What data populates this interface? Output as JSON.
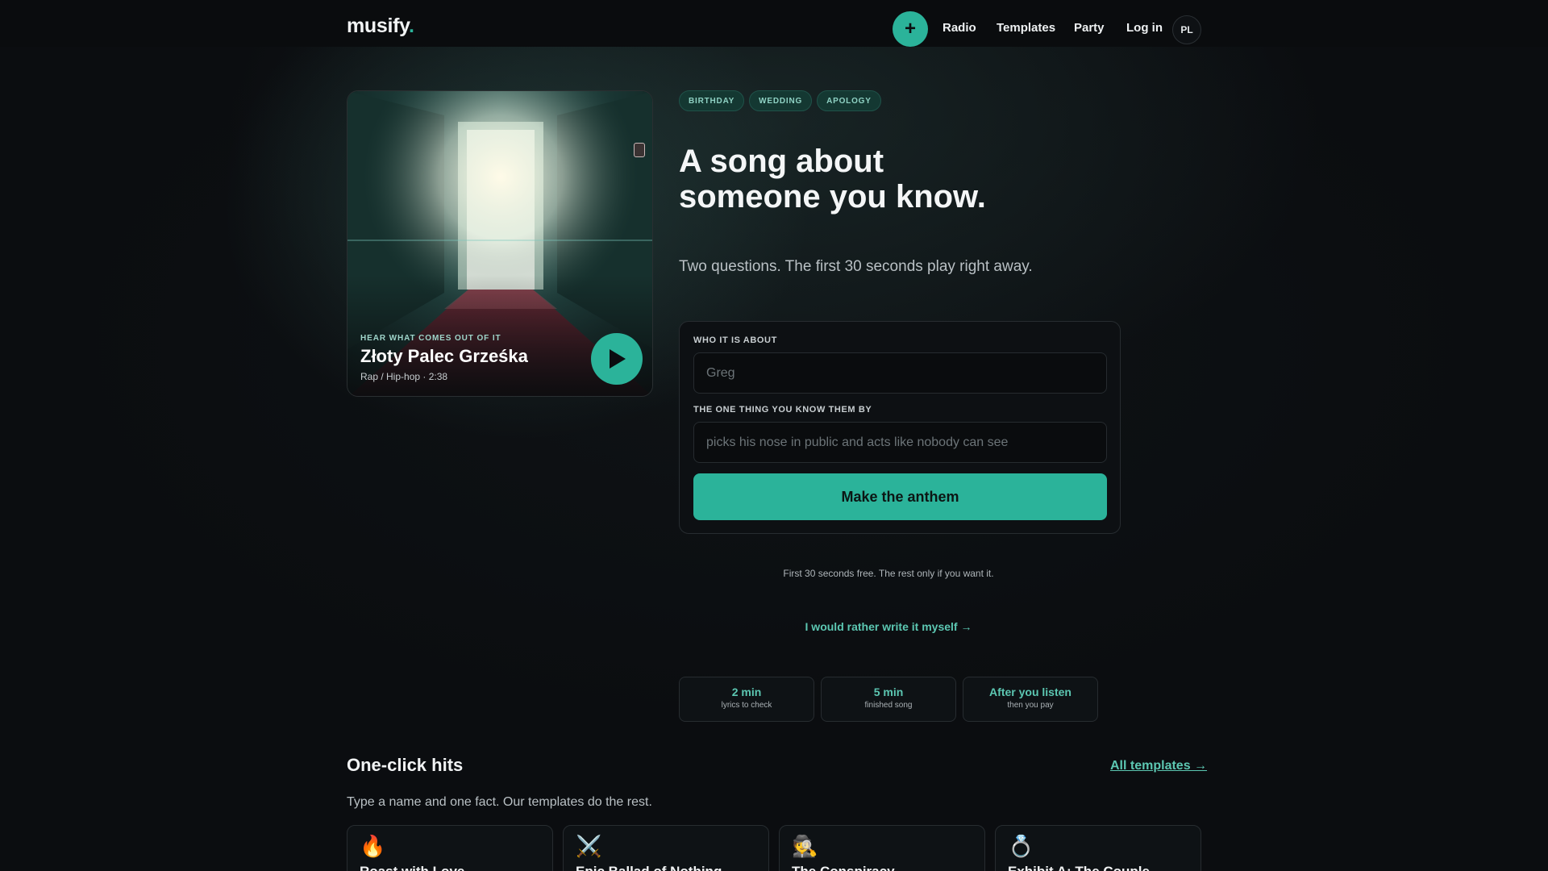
{
  "nav": {
    "logo": "musify",
    "logo_dot": ".",
    "plus_label": "+",
    "links": [
      "Radio",
      "Templates",
      "Party",
      "Log in"
    ],
    "lang": "PL"
  },
  "hero_card": {
    "eyebrow": "HEAR WHAT COMES OUT OF IT",
    "title": "Złoty Palec Grześka",
    "meta": "Rap / Hip-hop · 2:38",
    "play_icon": "play-icon"
  },
  "tags": [
    "BIRTHDAY",
    "WEDDING",
    "APOLOGY"
  ],
  "headline": {
    "line1": "A song about",
    "line2": "someone you know."
  },
  "subline": "Two questions. The first 30 seconds play right away.",
  "form": {
    "who_label": "WHO IT IS ABOUT",
    "who_placeholder": "Greg",
    "thing_label": "THE ONE THING YOU KNOW THEM BY",
    "thing_placeholder": "picks his nose in public and acts like nobody can see",
    "submit_label": "Make the anthem"
  },
  "note": "First 30 seconds free. The rest only if you want it.",
  "write_link": "I would rather write it myself →",
  "stats": [
    {
      "value": "2 min",
      "label": "lyrics to check"
    },
    {
      "value": "5 min",
      "label": "finished song"
    },
    {
      "value": "After you listen",
      "label": "then you pay"
    }
  ],
  "section": {
    "title": "One-click hits",
    "all_link": "All templates →",
    "subtitle": "Type a name and one fact. Our templates do the rest."
  },
  "templates": [
    {
      "icon": "🔥",
      "icon_name": "fire-icon",
      "title": "Roast with Love"
    },
    {
      "icon": "⚔️",
      "icon_name": "crossed-swords-icon",
      "title": "Epic Ballad of Nothing"
    },
    {
      "icon": "🕵️",
      "icon_name": "detective-icon",
      "title": "The Conspiracy"
    },
    {
      "icon": "💍",
      "icon_name": "ring-icon",
      "title": "Exhibit A: The Couple"
    }
  ],
  "colors": {
    "accent": "#2bb39a",
    "background": "#0b0d10",
    "tag_bg": "#143832"
  }
}
